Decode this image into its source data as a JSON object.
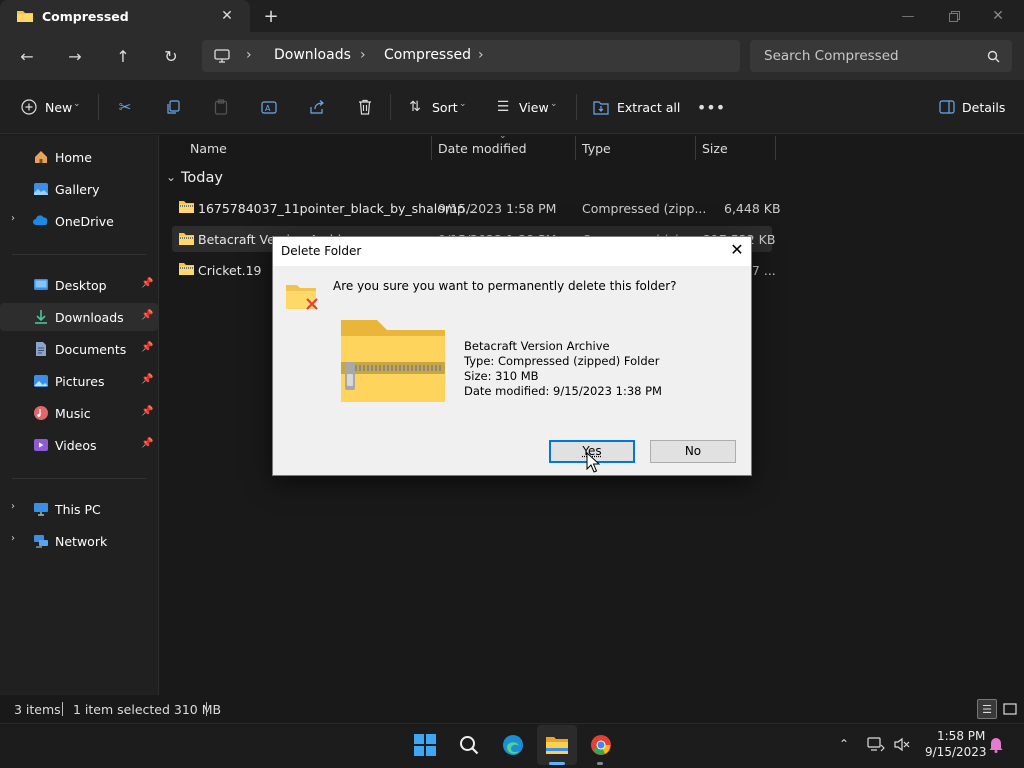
{
  "window": {
    "tab_title": "Compressed",
    "minimize_icon": "minimize-icon",
    "maximize_icon": "restore-icon",
    "close_icon": "close-icon"
  },
  "address": {
    "breadcrumbs": [
      "Downloads",
      "Compressed"
    ],
    "search_placeholder": "Search Compressed"
  },
  "commandbar": {
    "new_label": "New",
    "sort_label": "Sort",
    "view_label": "View",
    "extract_label": "Extract all",
    "details_label": "Details"
  },
  "nav": {
    "items": [
      {
        "label": "Home",
        "icon": "home-icon"
      },
      {
        "label": "Gallery",
        "icon": "gallery-icon"
      },
      {
        "label": "OneDrive",
        "icon": "onedrive-icon"
      },
      {
        "label": "Desktop",
        "icon": "desktop-icon"
      },
      {
        "label": "Downloads",
        "icon": "downloads-icon"
      },
      {
        "label": "Documents",
        "icon": "documents-icon"
      },
      {
        "label": "Pictures",
        "icon": "pictures-icon"
      },
      {
        "label": "Music",
        "icon": "music-icon"
      },
      {
        "label": "Videos",
        "icon": "videos-icon"
      },
      {
        "label": "This PC",
        "icon": "this-pc-icon"
      },
      {
        "label": "Network",
        "icon": "network-icon"
      }
    ]
  },
  "files": {
    "columns": [
      "Name",
      "Date modified",
      "Type",
      "Size"
    ],
    "group": "Today",
    "rows": [
      {
        "name": "1675784037_11pointer_black_by_shalomp...",
        "date": "9/15/2023 1:58 PM",
        "type": "Compressed (zipp...",
        "size": "6,448 KB"
      },
      {
        "name": "Betacraft Version Archive",
        "date": "9/15/2023 1:38 PM",
        "type": "Compressed (zipp...",
        "size": "317,532 KB"
      },
      {
        "name": "Cricket.19",
        "date": "",
        "type": "",
        "size": "...7 ..."
      }
    ]
  },
  "status": {
    "items": "3 items",
    "selected": "1 item selected  310 MB"
  },
  "dialog": {
    "title": "Delete Folder",
    "question": "Are you sure you want to permanently delete this folder?",
    "name": "Betacraft Version Archive",
    "type": "Type: Compressed (zipped) Folder",
    "size": "Size: 310 MB",
    "date": "Date modified: 9/15/2023 1:38 PM",
    "yes_label": "Yes",
    "no_label": "No"
  },
  "taskbar": {
    "time": "1:58 PM",
    "date": "9/15/2023"
  },
  "colors": {
    "accent": "#0078d7",
    "folder": "#f6c548",
    "background": "#191919"
  }
}
